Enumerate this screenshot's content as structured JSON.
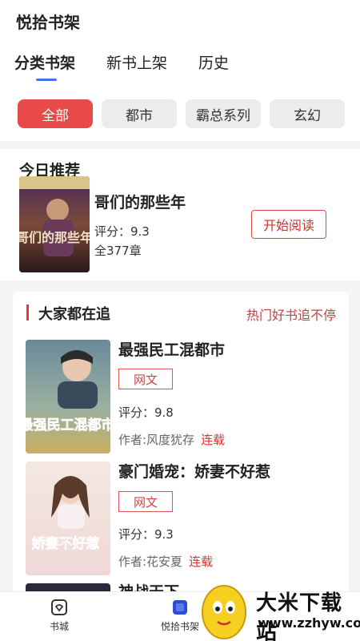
{
  "header": {
    "app_title": "悦拾书架"
  },
  "tabs": [
    {
      "label": "分类书架",
      "active": true
    },
    {
      "label": "新书上架",
      "active": false
    },
    {
      "label": "历史",
      "active": false
    }
  ],
  "chips": [
    {
      "label": "全部",
      "active": true
    },
    {
      "label": "都市",
      "active": false
    },
    {
      "label": "霸总系列",
      "active": false
    },
    {
      "label": "玄幻",
      "active": false
    }
  ],
  "recommend": {
    "section_title": "今日推荐",
    "book": {
      "title": "哥们的那些年",
      "score": "评分：9.3",
      "chapters": "全377章",
      "cover_text": "哥们的那些年"
    },
    "start_button": "开始阅读"
  },
  "hot": {
    "section_title": "大家都在追",
    "more_label": "热门好书追不停",
    "books": [
      {
        "title": "最强民工混都市",
        "tag": "网文",
        "score": "评分：9.8",
        "author": "作者:风度犹存",
        "status": "连载",
        "cover_text": "最强民工混都市"
      },
      {
        "title": "豪门婚宠：娇妻不好惹",
        "tag": "网文",
        "score": "评分：9.3",
        "author": "作者:花安夏",
        "status": "连载",
        "cover_text": "娇妻不好惹"
      },
      {
        "title": "神战天下",
        "tag": "",
        "score": "",
        "author": "",
        "status": ""
      }
    ]
  },
  "bottom_nav": [
    {
      "label": "书城",
      "icon": "bookstore-icon",
      "active": false
    },
    {
      "label": "悦拾书架",
      "icon": "bookshelf-icon",
      "active": true
    }
  ],
  "watermark": {
    "text": "大米下载站",
    "url": "www.zzhyw.com"
  },
  "colors": {
    "accent_red": "#e84a4a",
    "tab_indicator": "#4a72e6"
  }
}
